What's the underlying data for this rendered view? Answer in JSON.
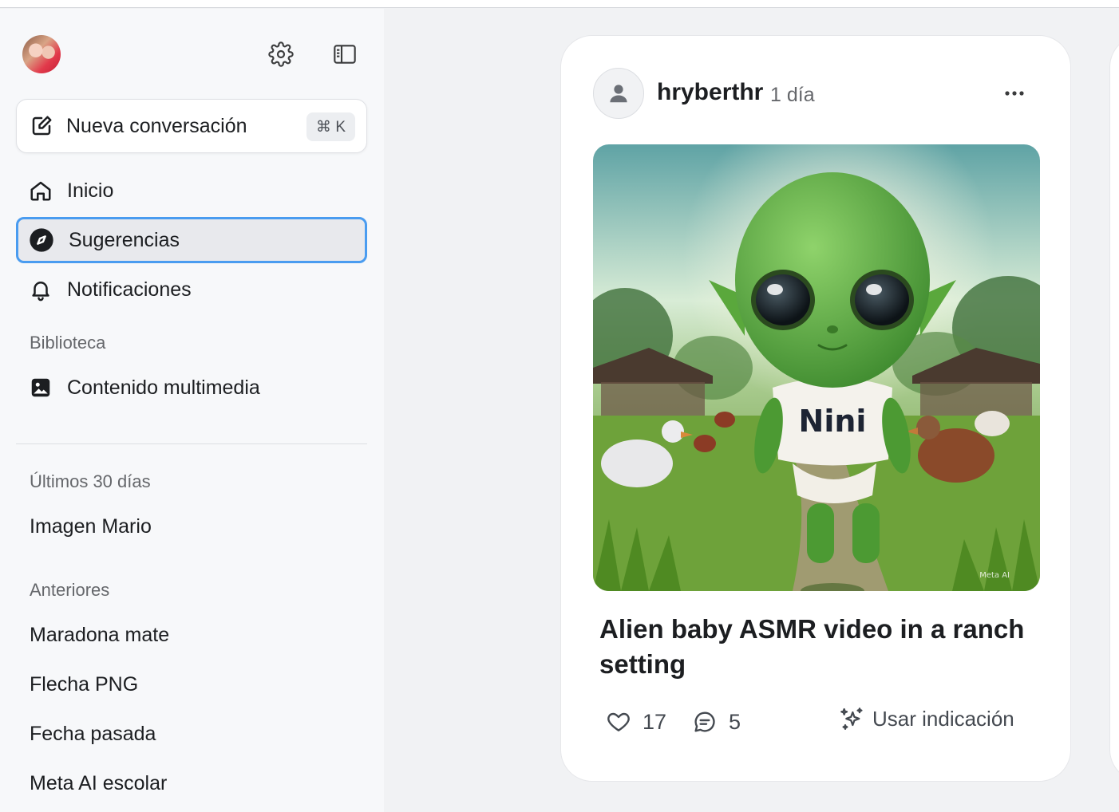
{
  "sidebar": {
    "new_conversation": {
      "label": "Nueva conversación",
      "shortcut": "⌘ K"
    },
    "nav": [
      {
        "label": "Inicio",
        "icon": "home-icon"
      },
      {
        "label": "Sugerencias",
        "icon": "compass-icon",
        "active": true
      },
      {
        "label": "Notificaciones",
        "icon": "bell-icon"
      }
    ],
    "library_heading": "Biblioteca",
    "library_item": {
      "label": "Contenido multimedia",
      "icon": "image-icon"
    },
    "recent_heading": "Últimos 30 días",
    "recent_items": [
      "Imagen Mario"
    ],
    "older_heading": "Anteriores",
    "older_items": [
      "Maradona mate",
      "Flecha PNG",
      "Fecha pasada",
      "Meta AI escolar"
    ]
  },
  "post": {
    "username": "hryberthr",
    "time": "1 día",
    "image_alt": "Green alien baby wearing a Nini shirt walking in a ranch with ducks",
    "shirt_text": "Nini",
    "watermark": "Meta AI",
    "caption": "Alien baby ASMR video in a ranch setting",
    "likes": "17",
    "comments": "5",
    "use_prompt_label": "Usar indicación"
  },
  "colors": {
    "accent_focus": "#4a9cf0",
    "sidebar_bg": "#f7f8fa",
    "main_bg": "#f1f2f4"
  }
}
